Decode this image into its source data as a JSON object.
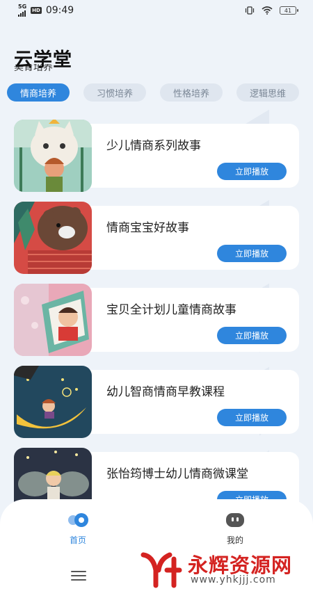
{
  "status_bar": {
    "network": "5G",
    "hd": "HD",
    "time": "09:49",
    "battery": "41"
  },
  "header": {
    "title": "云学堂",
    "subtitle_partial": "美育培养"
  },
  "tabs": [
    {
      "label": "情商培养",
      "active": true
    },
    {
      "label": "习惯培养",
      "active": false
    },
    {
      "label": "性格培养",
      "active": false
    },
    {
      "label": "逻辑思维",
      "active": false
    }
  ],
  "courses": [
    {
      "title": "少儿情商系列故事",
      "button": "立即播放",
      "thumb": "cat-and-kid"
    },
    {
      "title": "情商宝宝好故事",
      "button": "立即播放",
      "thumb": "bear"
    },
    {
      "title": "宝贝全计划儿童情商故事",
      "button": "立即播放",
      "thumb": "child-in-frame"
    },
    {
      "title": "幼儿智商情商早教课程",
      "button": "立即播放",
      "thumb": "girl-on-moon"
    },
    {
      "title": "张怡筠博士幼儿情商微课堂",
      "button": "立即播放",
      "thumb": "fairy"
    }
  ],
  "bottom_nav": {
    "home": "首页",
    "mine": "我的"
  },
  "watermark": {
    "brand": "永辉资源网",
    "url": "www.yhkjjj.com"
  },
  "colors": {
    "accent": "#2f86dd",
    "background": "#eef3f9",
    "watermark": "#d42321"
  }
}
